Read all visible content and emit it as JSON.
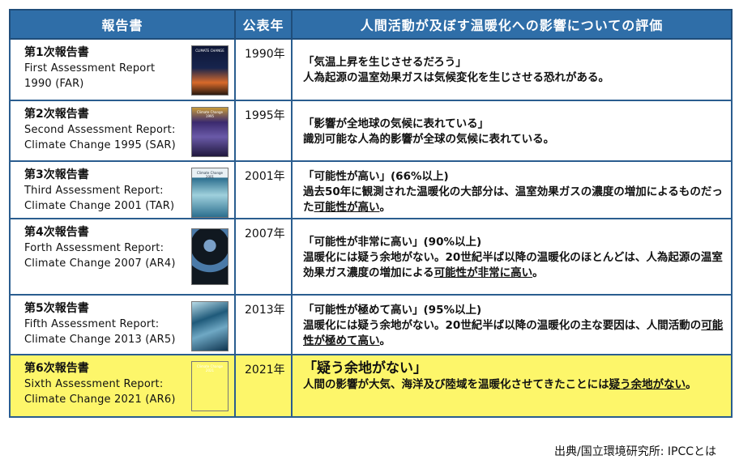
{
  "header": {
    "col_report": "報告書",
    "col_year": "公表年",
    "col_eval": "人間活動が及ぼす温暖化への影響についての評価"
  },
  "rows": [
    {
      "jp": "第1次報告書",
      "en1": "First Assessment Report",
      "en2": "1990 (FAR)",
      "year": "1990年",
      "quote": "「気温上昇を生じさせるだろう」",
      "text": "人為起源の温室効果ガスは気候変化を生じさせる恐れがある。",
      "underline": "",
      "after": "",
      "cover_title": "CLIMATE CHANGE",
      "cover_color": "#17244d",
      "cover_accent": "#d86a2a"
    },
    {
      "jp": "第2次報告書",
      "en1": "Second Assessment Report:",
      "en2": "Climate Change 1995 (SAR)",
      "year": "1995年",
      "quote": "「影響が全地球の気候に表れている」",
      "text": "識別可能な人為的影響が全球の気候に表れている。",
      "underline": "",
      "after": "",
      "cover_title": "Climate Change 1995",
      "cover_color": "#3b2a6e",
      "cover_accent": "#c79a3a"
    },
    {
      "jp": "第3次報告書",
      "en1": "Third Assessment Report:",
      "en2": "Climate Change 2001 (TAR)",
      "year": "2001年",
      "quote": "「可能性が高い」(66%以上)",
      "text": "過去50年に観測された温暖化の大部分は、温室効果ガスの濃度の増加によるものだった",
      "underline": "可能性が高い",
      "after": "。",
      "cover_title": "Climate Change 2001",
      "cover_color": "#2c6f8f",
      "cover_accent": "#9fd0dc"
    },
    {
      "jp": "第4次報告書",
      "en1": "Forth Assessment Report:",
      "en2": "Climate Change 2007 (AR4)",
      "year": "2007年",
      "quote": "「可能性が非常に高い」(90%以上)",
      "text": "温暖化には疑う余地がない。20世紀半ば以降の温暖化のほとんどは、人為起源の温室効果ガス濃度の増加による",
      "underline": "可能性が非常に高い",
      "after": "。",
      "cover_title": "",
      "cover_color": "#101820",
      "cover_accent": "#7aa0c8"
    },
    {
      "jp": "第5次報告書",
      "en1": "Fifth Assessment Report:",
      "en2": "Climate Change 2013 (AR5)",
      "year": "2013年",
      "quote": "「可能性が極めて高い」(95%以上)",
      "text": "温暖化には疑う余地がない。20世紀半ば以降の温暖化の主な要因は、人間活動の",
      "underline": "可能性が極めて高い",
      "after": "。",
      "cover_title": "",
      "cover_color": "#1f5a7a",
      "cover_accent": "#b8dbe8"
    },
    {
      "jp": "第6次報告書",
      "en1": "Sixth Assessment Report:",
      "en2": "Climate Change 2021 (AR6)",
      "year": "2021年",
      "quote": "「疑う余地がない」",
      "text": "人間の影響が大気、海洋及び陸域を温暖化させてきたことには",
      "underline": "疑う余地がない",
      "after": "。",
      "cover_title": "Climate Change 2021",
      "cover_color": "#3a5fb0",
      "cover_accent": "#d94a3a"
    }
  ],
  "source": "出典/国立環境研究所: IPCCとは"
}
